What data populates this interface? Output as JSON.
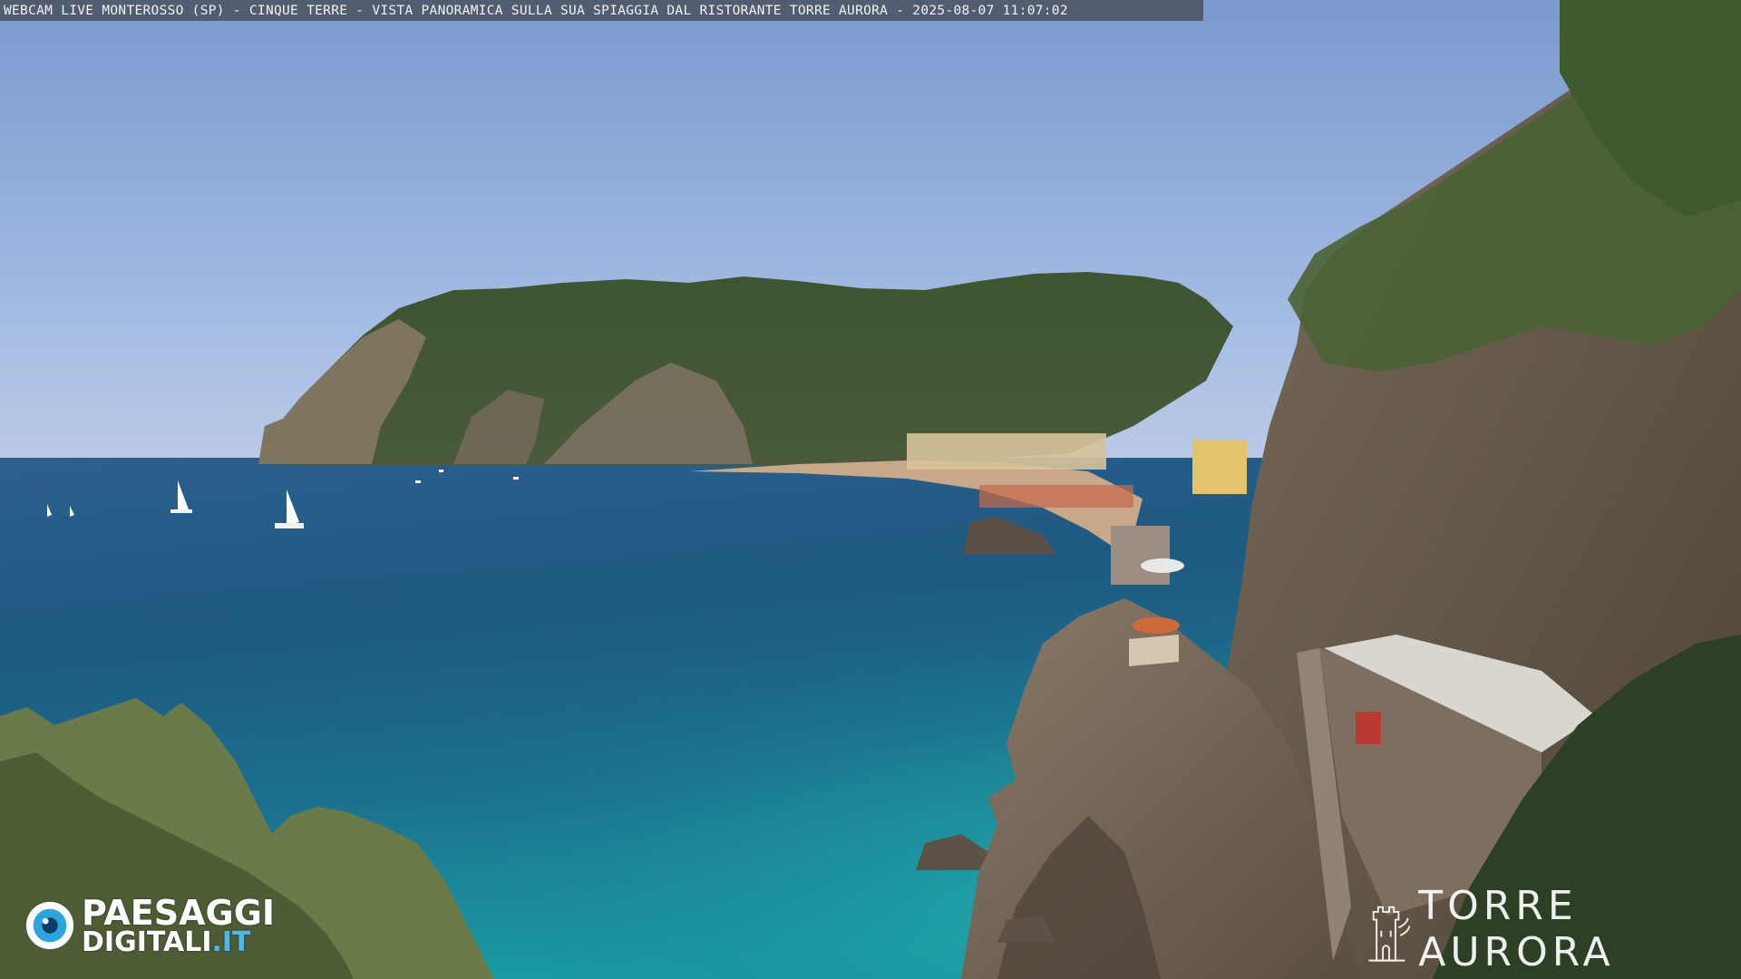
{
  "overlay": {
    "caption": "WEBCAM LIVE MONTEROSSO (SP) - CINQUE TERRE - VISTA PANORAMICA SULLA SUA SPIAGGIA DAL RISTORANTE TORRE AURORA - 2025-08-07 11:07:02"
  },
  "logos": {
    "left_line1": "PAESAGGI",
    "left_line2_main": "DIGITALI",
    "left_line2_suffix": ".IT",
    "left_icon": "eye-icon",
    "right_text": "TORRE AURORA",
    "right_icon": "tower-icon"
  },
  "colors": {
    "sky_top": "#7f9ed1",
    "sky_horizon": "#b5c8e6",
    "sea_deep": "#1b4c7a",
    "sea_turquoise": "#1f8fa0",
    "cliff": "#6d6052",
    "vegetation": "#3e5530",
    "logo_accent": "#4fb8e6"
  }
}
